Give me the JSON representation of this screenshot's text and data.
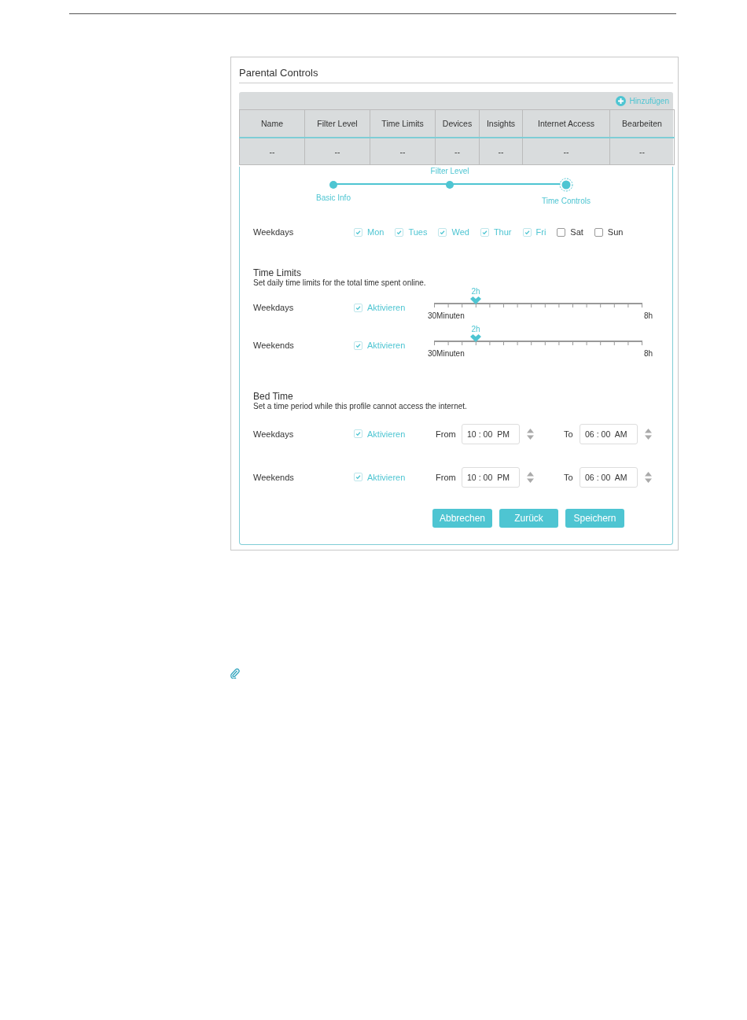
{
  "panel_title": "Parental Controls",
  "add_link": "Hinzufügen",
  "table": {
    "columns": [
      "Name",
      "Filter Level",
      "Time Limits",
      "Devices",
      "Insights",
      "Internet Access",
      "Bearbeiten"
    ],
    "rows": [
      [
        "--",
        "--",
        "--",
        "--",
        "--",
        "--",
        "--"
      ]
    ]
  },
  "steps": [
    {
      "label": "Basic Info",
      "current": false
    },
    {
      "label": "Filter Level",
      "current": false
    },
    {
      "label": "Time Controls",
      "current": true
    }
  ],
  "weekdays": {
    "label": "Weekdays",
    "days": [
      {
        "label": "Mon",
        "checked": true
      },
      {
        "label": "Tues",
        "checked": true
      },
      {
        "label": "Wed",
        "checked": true
      },
      {
        "label": "Thur",
        "checked": true
      },
      {
        "label": "Fri",
        "checked": true
      },
      {
        "label": "Sat",
        "checked": false
      },
      {
        "label": "Sun",
        "checked": false
      }
    ]
  },
  "time_limits": {
    "title": "Time Limits",
    "description": "Set daily time limits for the total time spent online.",
    "rows": [
      {
        "label": "Weekdays",
        "enable_label": "Aktivieren",
        "enabled": true,
        "value": "2h",
        "level": 0.2,
        "min_label": "30Minuten",
        "max_label": "8h"
      },
      {
        "label": "Weekends",
        "enable_label": "Aktivieren",
        "enabled": true,
        "value": "2h",
        "level": 0.2,
        "min_label": "30Minuten",
        "max_label": "8h"
      }
    ]
  },
  "bed_time": {
    "title": "Bed Time",
    "description": "Set a time period while this profile cannot access the internet.",
    "rows": [
      {
        "label": "Weekdays",
        "enable_label": "Aktivieren",
        "enabled": true,
        "from_label": "From",
        "from": {
          "hour": "10",
          "separator": ":",
          "minute": "00",
          "period": "PM"
        },
        "to_label": "To",
        "to": {
          "hour": "06",
          "separator": ":",
          "minute": "00",
          "period": "AM"
        }
      },
      {
        "label": "Weekends",
        "enable_label": "Aktivieren",
        "enabled": true,
        "from_label": "From",
        "from": {
          "hour": "10",
          "separator": ":",
          "minute": "00",
          "period": "PM"
        },
        "to_label": "To",
        "to": {
          "hour": "06",
          "separator": ":",
          "minute": "00",
          "period": "AM"
        }
      }
    ]
  },
  "buttons": [
    "Abbrechen",
    "Zurück",
    "Speichern"
  ]
}
